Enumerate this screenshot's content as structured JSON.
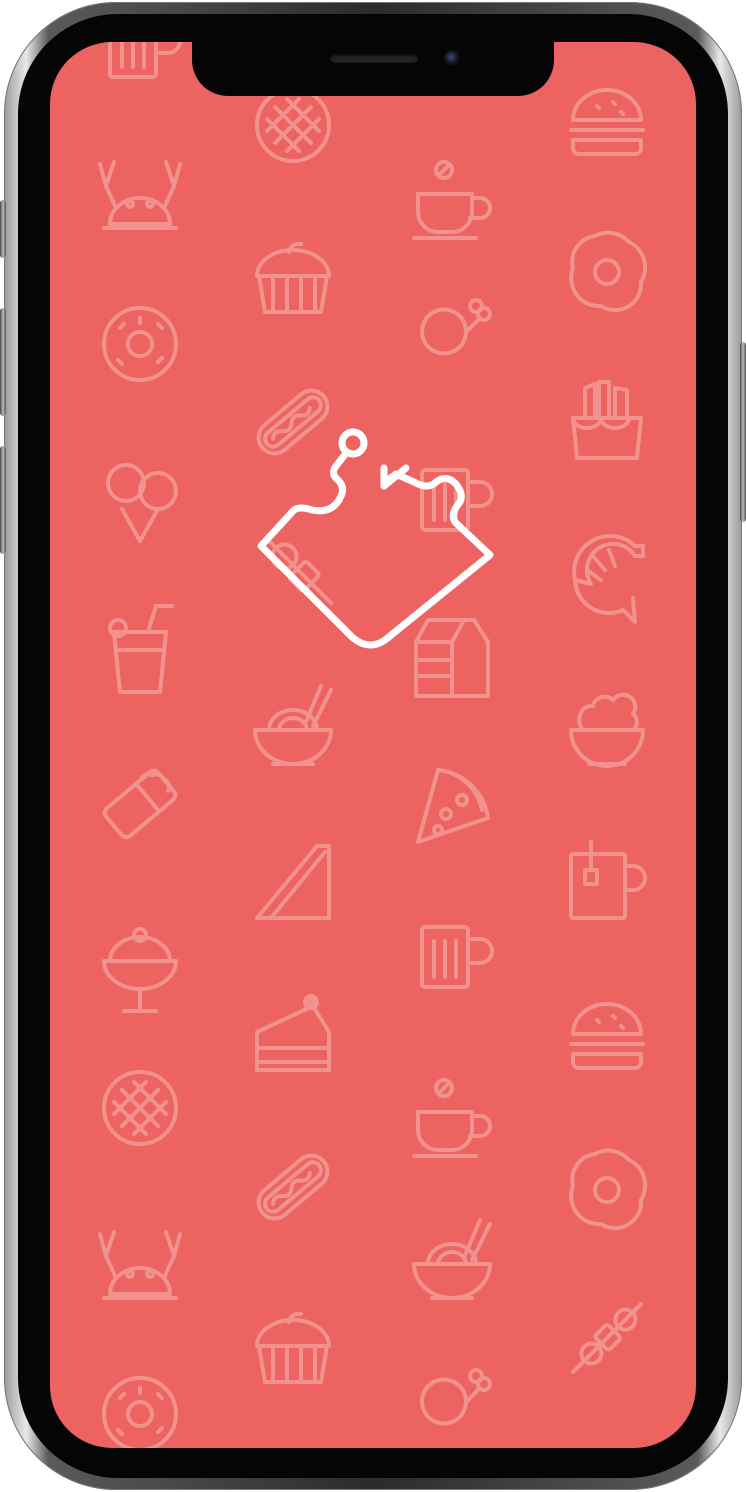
{
  "device": {
    "model": "iPhone X",
    "frame_color": "#2b2b2b"
  },
  "splash": {
    "background_color": "#ec6361",
    "pattern_icon_color": "#f2928f",
    "logo_color": "#ffffff",
    "logo_icon": "puzzle-tray-hook-logo",
    "pattern_icons": [
      "beer-mug-icon",
      "waffle-icon",
      "burger-icon",
      "crab-icon",
      "coffee-cup-icon",
      "cupcake-icon",
      "fried-egg-icon",
      "donut-icon",
      "chicken-leg-icon",
      "hot-dog-icon",
      "fries-icon",
      "ice-cream-cone-icon",
      "beer-mug-icon",
      "shrimp-icon",
      "drink-glass-icon",
      "milk-carton-icon",
      "noodle-bowl-icon",
      "salad-bowl-icon",
      "burrito-icon",
      "pizza-slice-icon",
      "sandwich-icon",
      "tea-mug-icon",
      "sundae-icon",
      "beer-mug-icon",
      "cake-slice-icon",
      "burger-icon",
      "waffle-icon",
      "coffee-cup-icon",
      "hot-dog-icon",
      "fried-egg-icon",
      "crab-icon",
      "noodle-bowl-icon",
      "cupcake-icon",
      "kebab-icon",
      "donut-icon",
      "chicken-leg-icon"
    ]
  }
}
